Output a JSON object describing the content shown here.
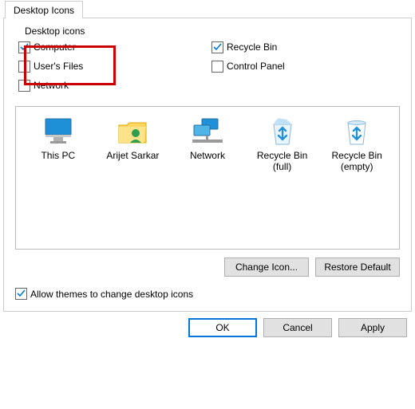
{
  "tab": {
    "label": "Desktop Icons"
  },
  "group": {
    "title": "Desktop icons"
  },
  "checks": {
    "col1": [
      {
        "label": "Computer",
        "checked": true
      },
      {
        "label": "User's Files",
        "checked": false
      },
      {
        "label": "Network",
        "checked": false
      }
    ],
    "col2": [
      {
        "label": "Recycle Bin",
        "checked": true
      },
      {
        "label": "Control Panel",
        "checked": false
      }
    ]
  },
  "icons": [
    {
      "name": "This PC",
      "icon": "pc"
    },
    {
      "name": "Arijet Sarkar",
      "icon": "userfolder"
    },
    {
      "name": "Network",
      "icon": "network"
    },
    {
      "name": "Recycle Bin\n(full)",
      "icon": "bin-full"
    },
    {
      "name": "Recycle Bin\n(empty)",
      "icon": "bin-empty"
    }
  ],
  "buttons": {
    "change_icon": "Change Icon...",
    "restore_default": "Restore Default",
    "ok": "OK",
    "cancel": "Cancel",
    "apply": "Apply"
  },
  "themes_checkbox": {
    "label": "Allow themes to change desktop icons",
    "checked": true
  },
  "colors": {
    "accent": "#0078d7",
    "highlight": "#cc0000"
  }
}
